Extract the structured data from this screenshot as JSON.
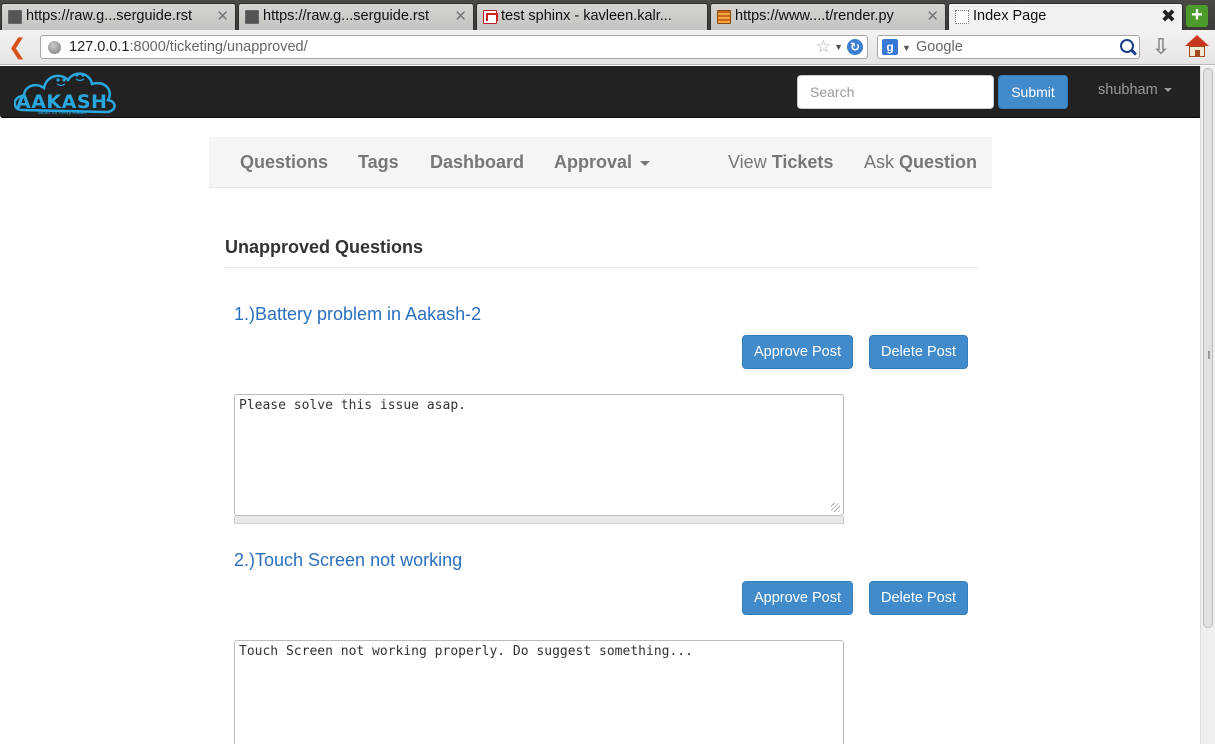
{
  "browser": {
    "tabs": [
      {
        "label": "https://raw.g...serguide.rst",
        "icon": "github-icon"
      },
      {
        "label": "https://raw.g...serguide.rst",
        "icon": "github-icon"
      },
      {
        "label": "test sphinx - kavleen.kalr...",
        "icon": "gmail-icon"
      },
      {
        "label": "https://www....t/render.py",
        "icon": "code-icon"
      },
      {
        "label": "Index Page",
        "icon": "blank-page-icon"
      }
    ],
    "url_host": "127.0.0.1",
    "url_path": ":8000/ticketing/unapproved/",
    "search_engine": "Google"
  },
  "header": {
    "logo_text": "AAKASH",
    "logo_tagline": "tablet for every Indian",
    "search_placeholder": "Search",
    "submit_label": "Submit",
    "user_name": "shubham"
  },
  "subnav": {
    "questions": "Questions",
    "tags": "Tags",
    "dashboard": "Dashboard",
    "approval": "Approval",
    "view_prefix": "View",
    "view_strong": "Tickets",
    "ask_prefix": "Ask",
    "ask_strong": "Question"
  },
  "page": {
    "title": "Unapproved Questions"
  },
  "questions": [
    {
      "title": "1.)Battery problem in Aakash-2",
      "approve_label": "Approve Post",
      "delete_label": "Delete Post",
      "body": "Please solve this issue asap."
    },
    {
      "title": "2.)Touch Screen not working",
      "approve_label": "Approve Post",
      "delete_label": "Delete Post",
      "body": "Touch Screen not working properly. Do suggest something..."
    }
  ],
  "colors": {
    "header_bg": "#222222",
    "primary_button": "#428bca",
    "link": "#2a6fbf",
    "logo": "#29a8e0"
  }
}
